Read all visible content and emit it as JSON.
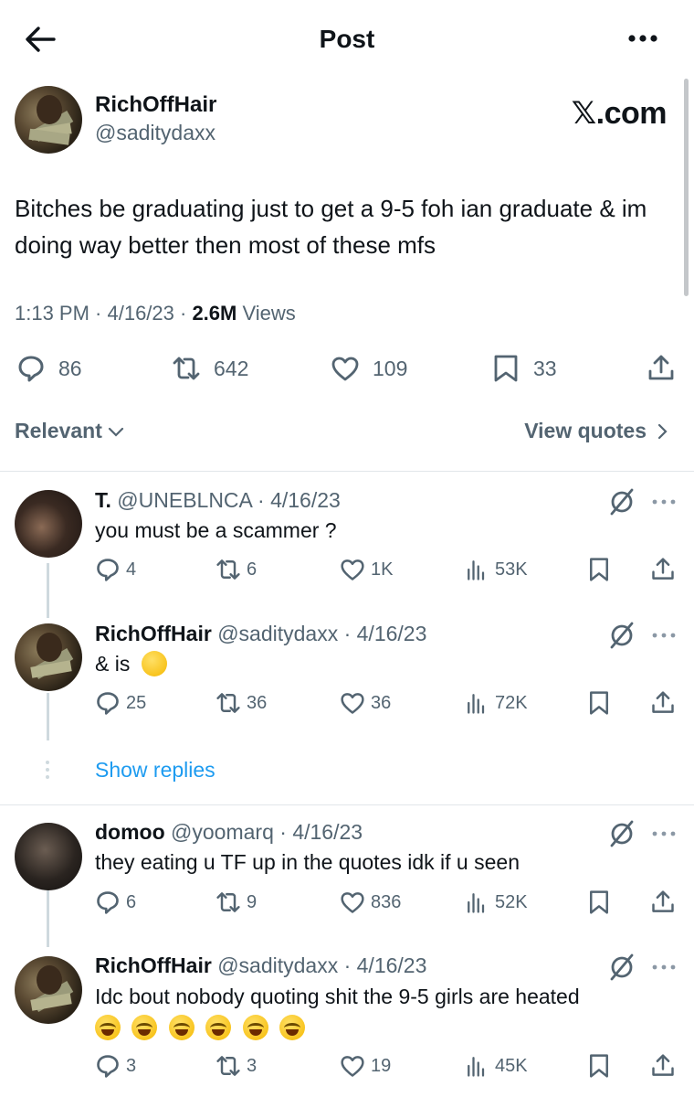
{
  "header": {
    "title": "Post"
  },
  "post": {
    "author_name": "RichOffHair",
    "author_handle": "@saditydaxx",
    "brand": "𝕏.com",
    "text": "Bitches be graduating just to get a 9-5 foh ian graduate & im doing way better then most of these mfs",
    "time": "1:13 PM · 4/16/23 · ",
    "views_count": "2.6M",
    "views_label": " Views",
    "replies": "86",
    "reposts": "642",
    "likes": "109",
    "bookmarks": "33"
  },
  "sort": {
    "label": "Relevant",
    "quotes_label": "View quotes"
  },
  "replies": [
    {
      "name": "T.",
      "handle": "@UNEBLNCA",
      "date": "· 4/16/23",
      "text": "you must be a scammer ?",
      "replies": "4",
      "reposts": "6",
      "likes": "1K",
      "views": "53K",
      "emoji": "",
      "avatar_colors": [
        "#3a2a22",
        "#8a6a55",
        "#1c1512"
      ]
    },
    {
      "name": "RichOffHair",
      "handle": "@saditydaxx",
      "date": "· 4/16/23",
      "text": "& is",
      "replies": "25",
      "reposts": "36",
      "likes": "36",
      "views": "72K",
      "emoji": "melting-face",
      "avatar_colors": [
        "#8a7a5a",
        "#5b4a33",
        "#1a140e"
      ]
    },
    {
      "name": "domoo",
      "handle": "@yoomarq",
      "date": "· 4/16/23",
      "text": "they eating u TF up in the quotes idk if u seen",
      "replies": "6",
      "reposts": "9",
      "likes": "836",
      "views": "52K",
      "emoji": "",
      "avatar_colors": [
        "#2a2420",
        "#6b5d52",
        "#12100e"
      ]
    },
    {
      "name": "RichOffHair",
      "handle": "@saditydaxx",
      "date": "· 4/16/23",
      "text": "Idc bout nobody quoting shit the 9-5 girls are heated",
      "replies": "3",
      "reposts": "3",
      "likes": "19",
      "views": "45K",
      "emoji": "crying-laughing-cat ×6",
      "avatar_colors": [
        "#8a7a5a",
        "#5b4a33",
        "#1a140e"
      ]
    }
  ],
  "thread": {
    "show_replies": "Show replies"
  },
  "colors": {
    "text": "#0f1419",
    "secondary": "#536471",
    "link": "#1d9bf0",
    "divider": "#e1e6ea"
  }
}
